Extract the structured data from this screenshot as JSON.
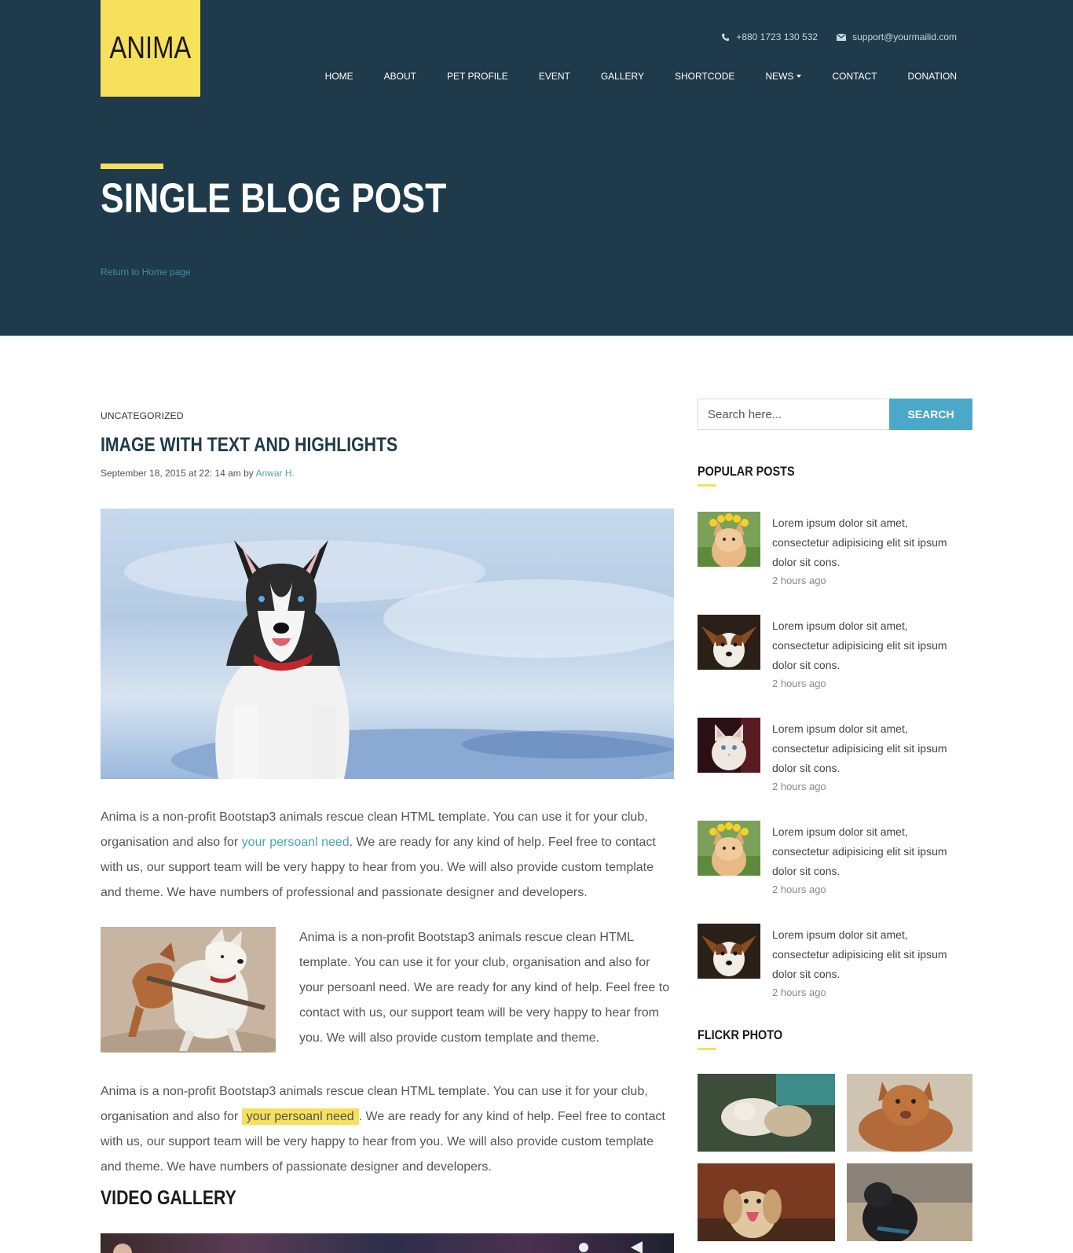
{
  "header": {
    "logo": "ANIMA",
    "phone": "+880 1723 130 532",
    "email": "support@yourmailid.com",
    "nav": [
      {
        "label": "HOME"
      },
      {
        "label": "ABOUT"
      },
      {
        "label": "PET PROFILE"
      },
      {
        "label": "EVENT"
      },
      {
        "label": "GALLERY"
      },
      {
        "label": "SHORTCODE"
      },
      {
        "label": "NEWS"
      },
      {
        "label": "CONTACT"
      },
      {
        "label": "DONATION"
      }
    ],
    "page_title": "SINGLE BLOG POST",
    "breadcrumb": "Return to Home page"
  },
  "post": {
    "category": "UNCATEGORIZED",
    "title": "IMAGE WITH TEXT AND HIGHLIGHTS",
    "meta_prefix": "September 18, 2015 at 22: 14 am by ",
    "author": "Anwar H.",
    "para1_a": "Anima is a non-profit Bootstap3 animals rescue clean HTML template. You can use it for your club, organisation and also for ",
    "para1_link": "your persoanl need",
    "para1_b": ". We are ready for any kind of help. Feel free to contact with us, our support team will be very happy to hear from you. We will also provide custom template and theme. We have numbers of professional and passionate designer and developers.",
    "para2": "Anima is a non-profit Bootstap3 animals rescue clean HTML template. You can use it for your club, organisation and also for your persoanl need. We are ready for any kind of help. Feel free to contact with us, our support team will be very happy to hear from you. We will also provide custom template and theme.",
    "para3_a": "Anima is a non-profit Bootstap3 animals rescue clean HTML template. You can use it for your club, organisation and also for ",
    "para3_highlight": "your persoanl need",
    "para3_b": ". We are ready for any kind of help. Feel free to contact with us, our support team will be very happy to hear from you. We will also provide custom template and theme. We have numbers of passionate designer and developers.",
    "video_title": "VIDEO GALLERY"
  },
  "sidebar": {
    "search_placeholder": "Search here...",
    "search_button": "SEARCH",
    "popular_title": "POPULAR POSTS",
    "popular": [
      {
        "text": "Lorem ipsum dolor sit amet, consectetur adipisicing elit sit ipsum dolor sit cons.",
        "time": "2 hours ago"
      },
      {
        "text": "Lorem ipsum dolor sit amet, consectetur adipisicing elit sit ipsum dolor sit cons.",
        "time": "2 hours ago"
      },
      {
        "text": "Lorem ipsum dolor sit amet, consectetur adipisicing elit sit ipsum dolor sit cons.",
        "time": "2 hours ago"
      },
      {
        "text": "Lorem ipsum dolor sit amet, consectetur adipisicing elit sit ipsum dolor sit cons.",
        "time": "2 hours ago"
      },
      {
        "text": "Lorem ipsum dolor sit amet, consectetur adipisicing elit sit ipsum dolor sit cons.",
        "time": "2 hours ago"
      }
    ],
    "flickr_title": "FLICKR PHOTO"
  },
  "colors": {
    "header_bg": "#1f3a4a",
    "accent_yellow": "#f6e05c",
    "accent_blue": "#4ba8c9",
    "link": "#4aa3b8"
  }
}
